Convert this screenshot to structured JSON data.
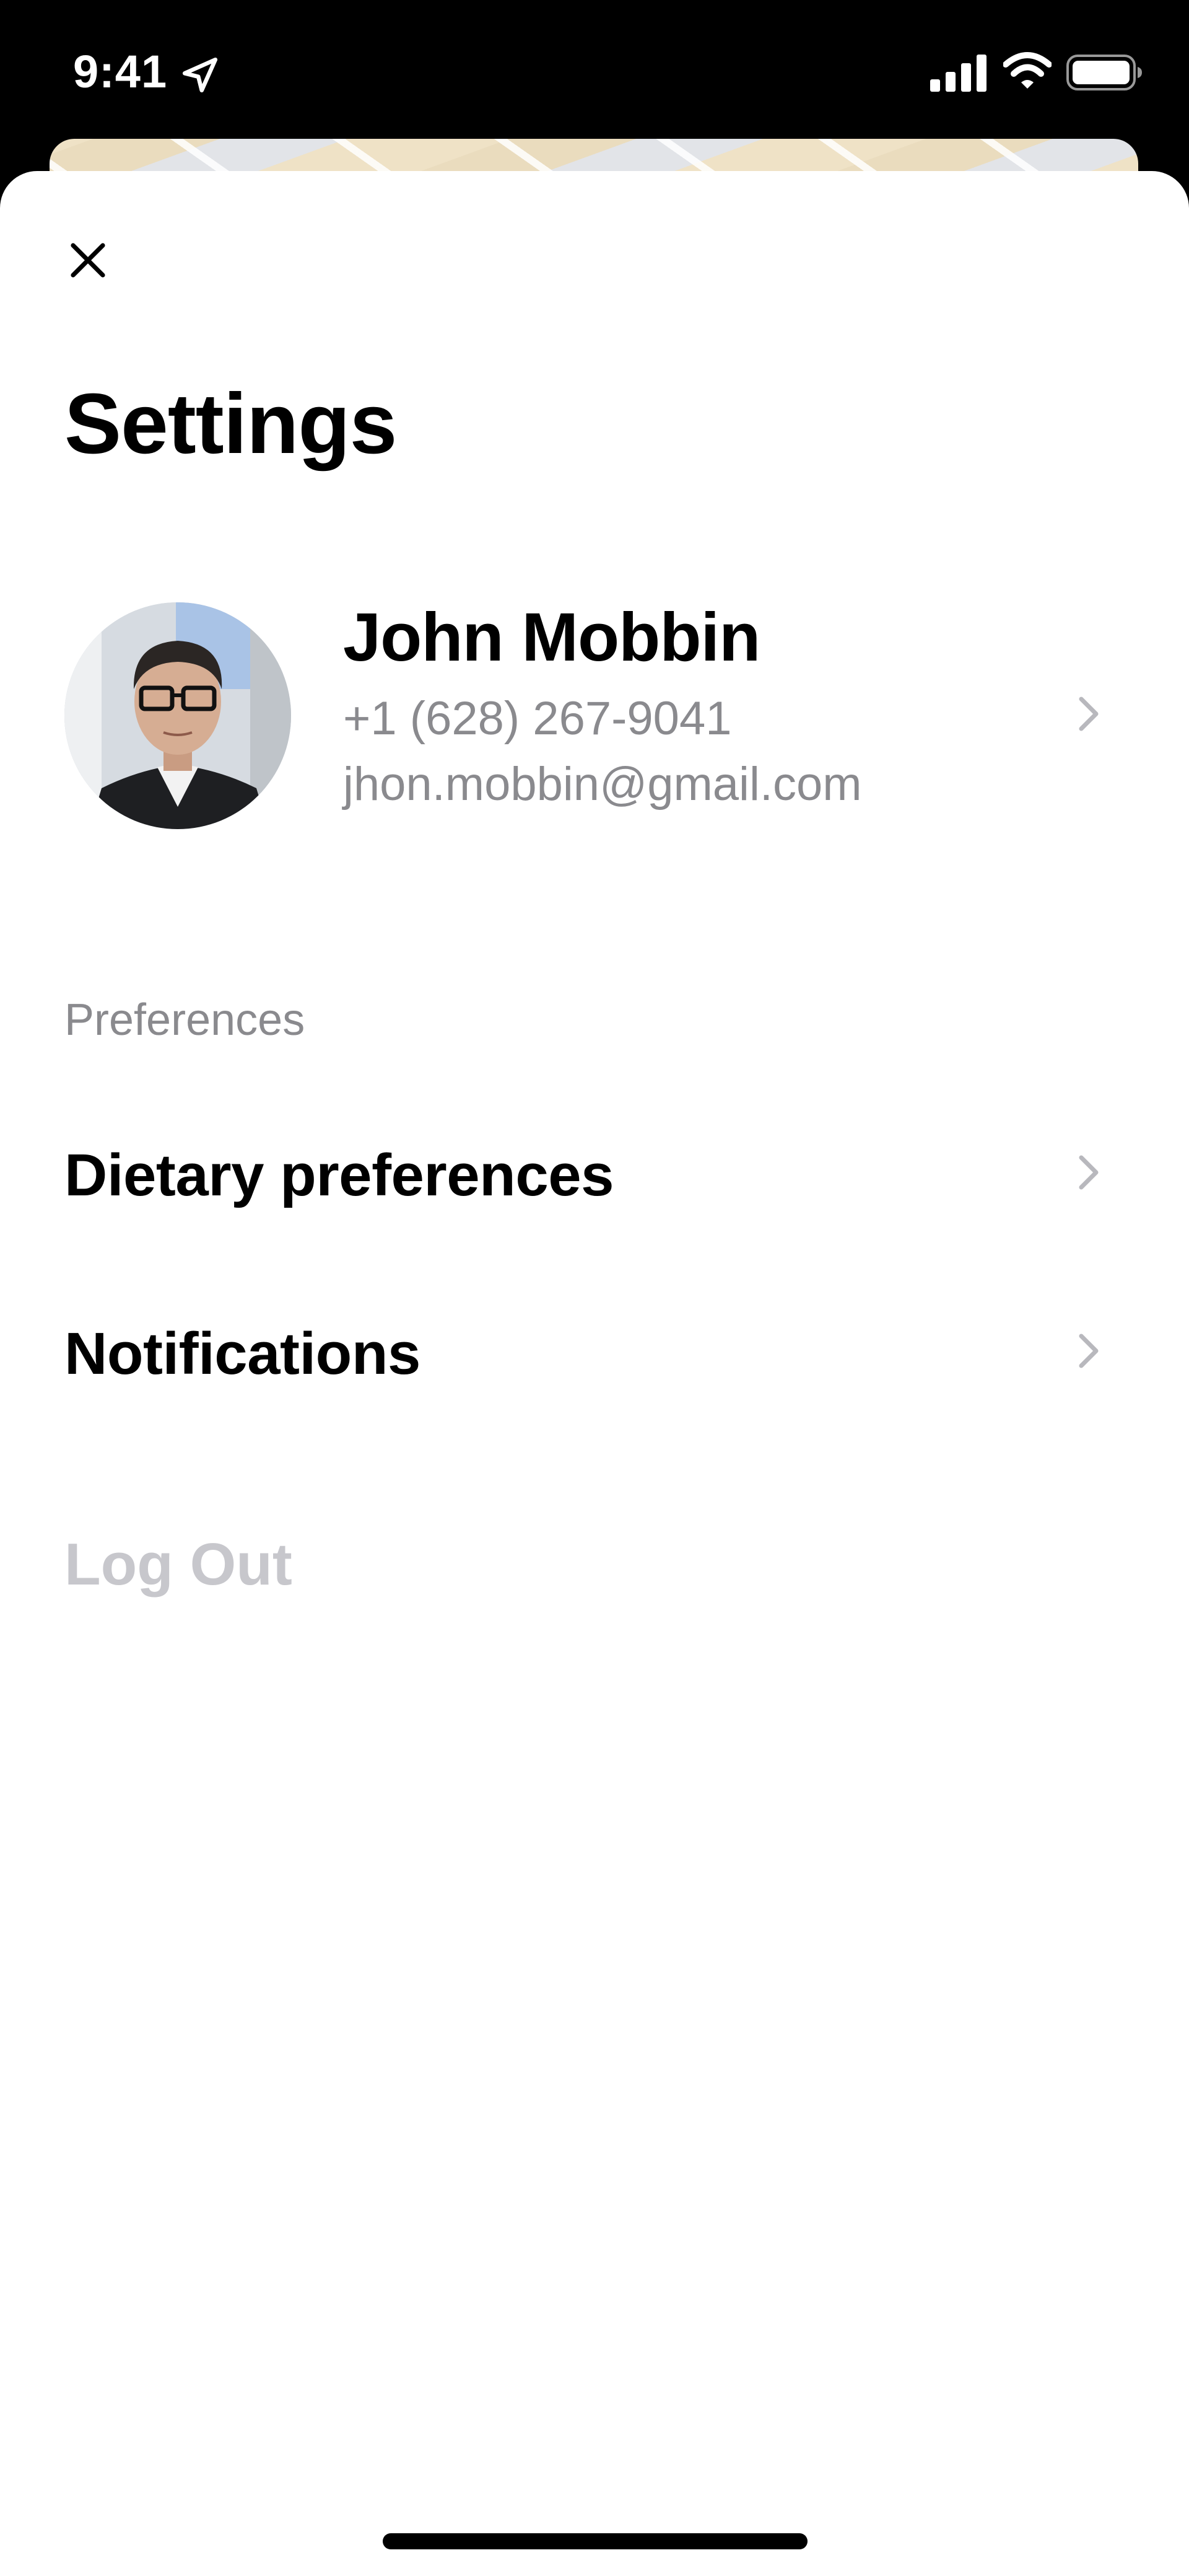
{
  "status_bar": {
    "time": "9:41",
    "icons": [
      "location-arrow-icon",
      "cellular-signal-icon",
      "wifi-icon",
      "battery-icon"
    ]
  },
  "header": {
    "close_icon": "close-icon",
    "title": "Settings"
  },
  "profile": {
    "name": "John Mobbin",
    "phone": "+1 (628) 267-9041",
    "email": "jhon.mobbin@gmail.com",
    "chevron_icon": "chevron-right-icon"
  },
  "preferences": {
    "section_label": "Preferences",
    "items": [
      {
        "label": "Dietary preferences",
        "icon": "chevron-right-icon"
      },
      {
        "label": "Notifications",
        "icon": "chevron-right-icon"
      }
    ]
  },
  "logout": {
    "label": "Log Out"
  },
  "colors": {
    "primary_text": "#000000",
    "secondary_text": "#8a8a8e",
    "disabled_text": "#c7c7cc",
    "chevron": "#b8b8bd",
    "background": "#ffffff"
  }
}
